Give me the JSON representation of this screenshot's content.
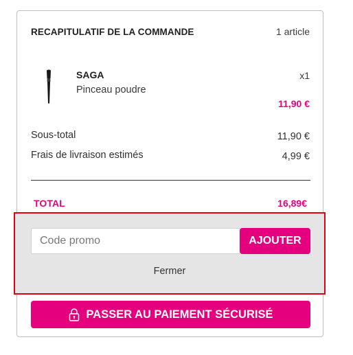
{
  "summary": {
    "title": "RECAPITULATIF DE LA COMMANDE",
    "item_count": "1 article"
  },
  "product": {
    "brand": "SAGA",
    "name": "Pinceau poudre",
    "quantity": "x1",
    "price": "11,90 €",
    "thumbnail_icon": "makeup-brush-icon"
  },
  "totals": {
    "subtotal_label": "Sous-total",
    "subtotal_value": "11,90 €",
    "shipping_label": "Frais de livraison estimés",
    "shipping_value": "4,99 €",
    "total_label": "TOTAL",
    "total_value": "16,89€"
  },
  "promo": {
    "placeholder": "Code promo",
    "add_label": "AJOUTER",
    "close_label": "Fermer"
  },
  "checkout": {
    "pay_label": "PASSER AU PAIEMENT SÉCURISÉ",
    "pay_icon": "lock-icon"
  },
  "colors": {
    "accent": "#e5007e",
    "highlight_border": "#e0000f",
    "panel_bg": "#e5e5e5"
  }
}
